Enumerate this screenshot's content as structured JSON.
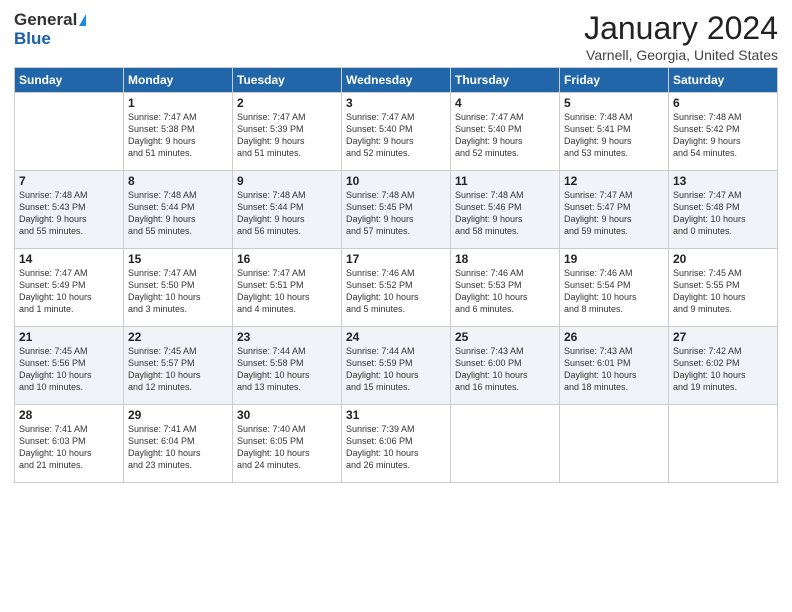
{
  "logo": {
    "general": "General",
    "blue": "Blue"
  },
  "title": "January 2024",
  "subtitle": "Varnell, Georgia, United States",
  "days_of_week": [
    "Sunday",
    "Monday",
    "Tuesday",
    "Wednesday",
    "Thursday",
    "Friday",
    "Saturday"
  ],
  "weeks": [
    [
      {
        "day": "",
        "content": ""
      },
      {
        "day": "1",
        "content": "Sunrise: 7:47 AM\nSunset: 5:38 PM\nDaylight: 9 hours\nand 51 minutes."
      },
      {
        "day": "2",
        "content": "Sunrise: 7:47 AM\nSunset: 5:39 PM\nDaylight: 9 hours\nand 51 minutes."
      },
      {
        "day": "3",
        "content": "Sunrise: 7:47 AM\nSunset: 5:40 PM\nDaylight: 9 hours\nand 52 minutes."
      },
      {
        "day": "4",
        "content": "Sunrise: 7:47 AM\nSunset: 5:40 PM\nDaylight: 9 hours\nand 52 minutes."
      },
      {
        "day": "5",
        "content": "Sunrise: 7:48 AM\nSunset: 5:41 PM\nDaylight: 9 hours\nand 53 minutes."
      },
      {
        "day": "6",
        "content": "Sunrise: 7:48 AM\nSunset: 5:42 PM\nDaylight: 9 hours\nand 54 minutes."
      }
    ],
    [
      {
        "day": "7",
        "content": "Sunrise: 7:48 AM\nSunset: 5:43 PM\nDaylight: 9 hours\nand 55 minutes."
      },
      {
        "day": "8",
        "content": "Sunrise: 7:48 AM\nSunset: 5:44 PM\nDaylight: 9 hours\nand 55 minutes."
      },
      {
        "day": "9",
        "content": "Sunrise: 7:48 AM\nSunset: 5:44 PM\nDaylight: 9 hours\nand 56 minutes."
      },
      {
        "day": "10",
        "content": "Sunrise: 7:48 AM\nSunset: 5:45 PM\nDaylight: 9 hours\nand 57 minutes."
      },
      {
        "day": "11",
        "content": "Sunrise: 7:48 AM\nSunset: 5:46 PM\nDaylight: 9 hours\nand 58 minutes."
      },
      {
        "day": "12",
        "content": "Sunrise: 7:47 AM\nSunset: 5:47 PM\nDaylight: 9 hours\nand 59 minutes."
      },
      {
        "day": "13",
        "content": "Sunrise: 7:47 AM\nSunset: 5:48 PM\nDaylight: 10 hours\nand 0 minutes."
      }
    ],
    [
      {
        "day": "14",
        "content": "Sunrise: 7:47 AM\nSunset: 5:49 PM\nDaylight: 10 hours\nand 1 minute."
      },
      {
        "day": "15",
        "content": "Sunrise: 7:47 AM\nSunset: 5:50 PM\nDaylight: 10 hours\nand 3 minutes."
      },
      {
        "day": "16",
        "content": "Sunrise: 7:47 AM\nSunset: 5:51 PM\nDaylight: 10 hours\nand 4 minutes."
      },
      {
        "day": "17",
        "content": "Sunrise: 7:46 AM\nSunset: 5:52 PM\nDaylight: 10 hours\nand 5 minutes."
      },
      {
        "day": "18",
        "content": "Sunrise: 7:46 AM\nSunset: 5:53 PM\nDaylight: 10 hours\nand 6 minutes."
      },
      {
        "day": "19",
        "content": "Sunrise: 7:46 AM\nSunset: 5:54 PM\nDaylight: 10 hours\nand 8 minutes."
      },
      {
        "day": "20",
        "content": "Sunrise: 7:45 AM\nSunset: 5:55 PM\nDaylight: 10 hours\nand 9 minutes."
      }
    ],
    [
      {
        "day": "21",
        "content": "Sunrise: 7:45 AM\nSunset: 5:56 PM\nDaylight: 10 hours\nand 10 minutes."
      },
      {
        "day": "22",
        "content": "Sunrise: 7:45 AM\nSunset: 5:57 PM\nDaylight: 10 hours\nand 12 minutes."
      },
      {
        "day": "23",
        "content": "Sunrise: 7:44 AM\nSunset: 5:58 PM\nDaylight: 10 hours\nand 13 minutes."
      },
      {
        "day": "24",
        "content": "Sunrise: 7:44 AM\nSunset: 5:59 PM\nDaylight: 10 hours\nand 15 minutes."
      },
      {
        "day": "25",
        "content": "Sunrise: 7:43 AM\nSunset: 6:00 PM\nDaylight: 10 hours\nand 16 minutes."
      },
      {
        "day": "26",
        "content": "Sunrise: 7:43 AM\nSunset: 6:01 PM\nDaylight: 10 hours\nand 18 minutes."
      },
      {
        "day": "27",
        "content": "Sunrise: 7:42 AM\nSunset: 6:02 PM\nDaylight: 10 hours\nand 19 minutes."
      }
    ],
    [
      {
        "day": "28",
        "content": "Sunrise: 7:41 AM\nSunset: 6:03 PM\nDaylight: 10 hours\nand 21 minutes."
      },
      {
        "day": "29",
        "content": "Sunrise: 7:41 AM\nSunset: 6:04 PM\nDaylight: 10 hours\nand 23 minutes."
      },
      {
        "day": "30",
        "content": "Sunrise: 7:40 AM\nSunset: 6:05 PM\nDaylight: 10 hours\nand 24 minutes."
      },
      {
        "day": "31",
        "content": "Sunrise: 7:39 AM\nSunset: 6:06 PM\nDaylight: 10 hours\nand 26 minutes."
      },
      {
        "day": "",
        "content": ""
      },
      {
        "day": "",
        "content": ""
      },
      {
        "day": "",
        "content": ""
      }
    ]
  ]
}
